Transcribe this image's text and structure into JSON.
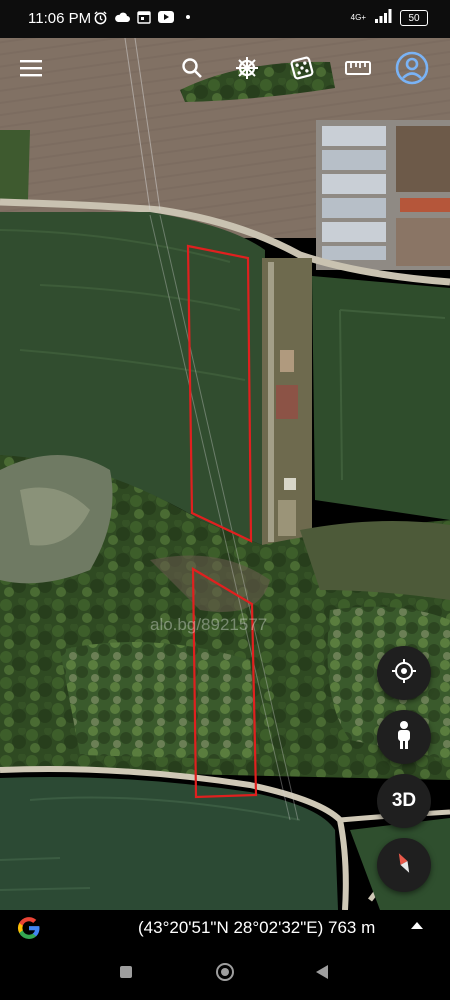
{
  "status_bar": {
    "time": "11:06 PM",
    "network": "4G+",
    "battery": "50",
    "notification_icons": [
      "alarm-icon",
      "cloud-icon",
      "calendar-icon",
      "youtube-icon",
      "dot-icon"
    ]
  },
  "toolbar": {
    "icons": [
      "menu-icon",
      "search-icon",
      "voyager-wheel-icon",
      "dice-icon",
      "ruler-icon",
      "account-icon"
    ]
  },
  "map": {
    "type": "satellite",
    "watermark": "alo.bg/8921577",
    "overlay_color": "#e0201f"
  },
  "controls": {
    "my_location_icon": "crosshair-icon",
    "pegman_icon": "pegman-icon",
    "view_toggle_label": "3D",
    "compass_icon": "compass-icon"
  },
  "bottom_bar": {
    "logo": "google-g-icon",
    "coordinates": "(43°20'51\"N 28°02'32\"E) 763 m"
  },
  "nav": {
    "buttons": [
      "recents-button",
      "home-button",
      "back-button"
    ]
  }
}
